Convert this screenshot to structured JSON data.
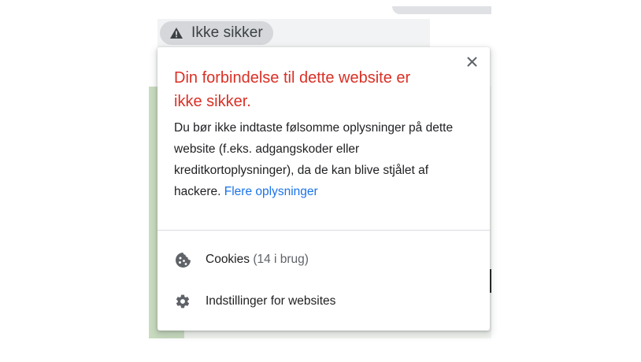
{
  "security_chip": {
    "icon": "warning-triangle-icon",
    "label": "Ikke sikker"
  },
  "popup": {
    "close_icon": "close-icon",
    "title_line1": "Din forbindelse til dette website er",
    "title_line2": "ikke sikker.",
    "body_text": "Du bør ikke indtaste følsomme oplysninger på dette website (f.eks. adgangskoder eller kreditkortoplysninger), da de kan blive stjålet af hackere.",
    "learn_more_link": "Flere oplysninger",
    "rows": [
      {
        "icon": "cookie-icon",
        "label": "Cookies",
        "detail": "(14 i brug)"
      },
      {
        "icon": "gear-icon",
        "label": "Indstillinger for websites"
      }
    ]
  },
  "colors": {
    "warning_title": "#d93025",
    "link": "#1a73e8",
    "text": "#202124",
    "muted": "#5f6368",
    "chip_bg": "#d5d7da"
  }
}
